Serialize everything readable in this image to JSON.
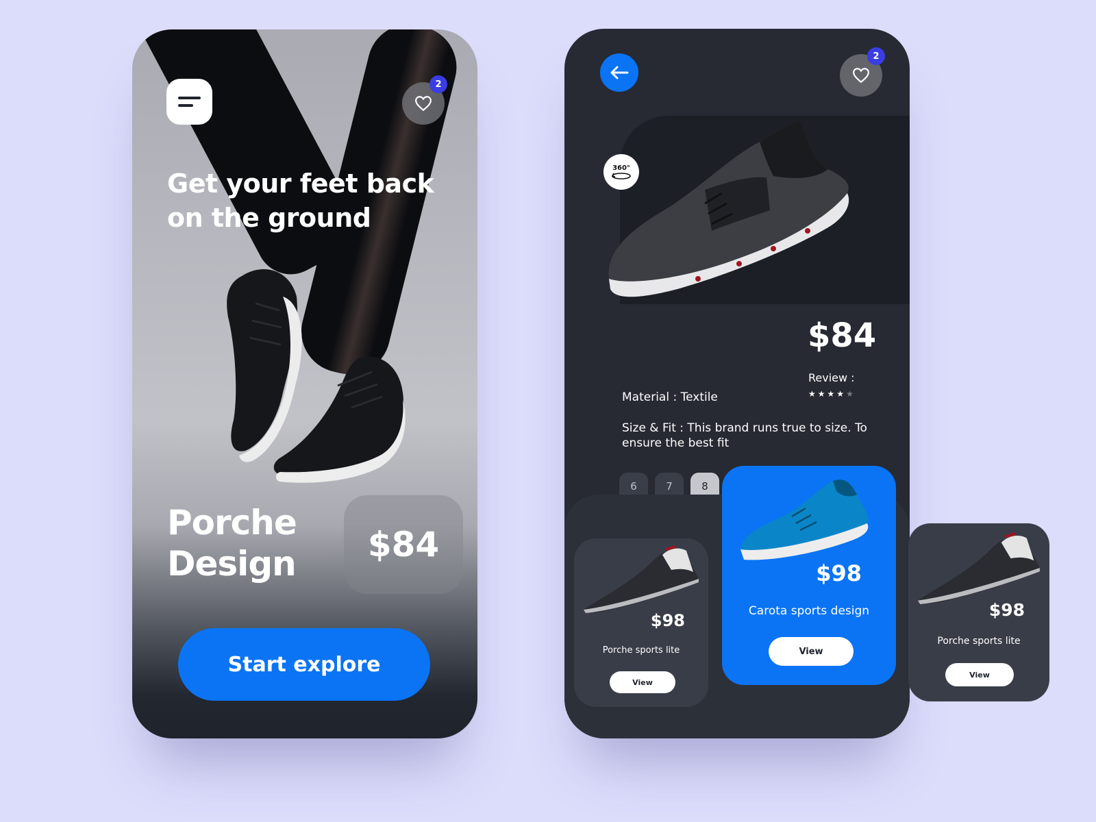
{
  "onboarding": {
    "heart_badge": "2",
    "headline": "Get your feet back on the ground",
    "product_name": "Porche Design",
    "price": "$84",
    "cta_label": "Start explore"
  },
  "details": {
    "heart_badge": "2",
    "rotate_label": "360°",
    "price": "$84",
    "review_label": "Review :",
    "rating": 4,
    "rating_max": 5,
    "material": "Material : Textile",
    "size_fit": "Size & Fit : This brand runs true to size. To ensure the best fit",
    "sizes": [
      "6",
      "7",
      "8"
    ],
    "selected_size": "8",
    "cards": [
      {
        "price": "$98",
        "name": "Porche sports lite",
        "view_label": "View"
      },
      {
        "price": "$98",
        "name": "Carota sports design",
        "view_label": "View"
      },
      {
        "price": "$98",
        "name": "Porche sports lite",
        "view_label": "View"
      }
    ]
  },
  "colors": {
    "background": "#dcdcfb",
    "accent": "#0a74f5",
    "badge": "#3a3de0",
    "panel_dark": "#272a33",
    "card": "#393d48"
  }
}
